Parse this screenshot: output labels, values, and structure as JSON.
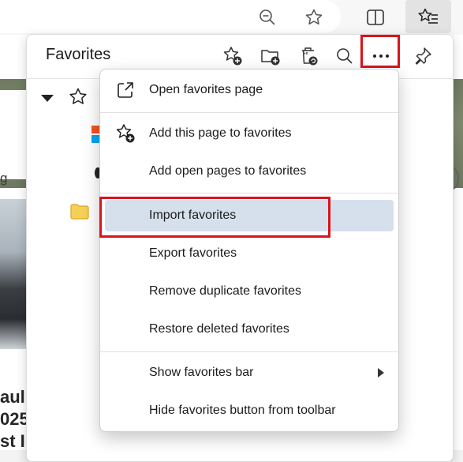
{
  "toolbar": {
    "icons": [
      "zoom-out-icon",
      "favorite-star-icon",
      "split-screen-icon",
      "favorites-list-icon"
    ]
  },
  "background_page": {
    "text_fragments": [
      "ng",
      "g",
      "aul",
      "025",
      "st I"
    ]
  },
  "favorites_panel": {
    "title": "Favorites",
    "header_icons": [
      "add-favorite-icon",
      "add-folder-icon",
      "delete-icon",
      "search-icon",
      "more-options-icon",
      "pin-icon"
    ]
  },
  "menu": {
    "items": [
      {
        "label": "Open favorites page",
        "icon": "open-external-icon"
      },
      {
        "label": "Add this page to favorites",
        "icon": "add-star-icon"
      },
      {
        "label": "Add open pages to favorites",
        "icon": ""
      },
      {
        "label": "Import favorites",
        "icon": ""
      },
      {
        "label": "Export favorites",
        "icon": ""
      },
      {
        "label": "Remove duplicate favorites",
        "icon": ""
      },
      {
        "label": "Restore deleted favorites",
        "icon": ""
      },
      {
        "label": "Show favorites bar",
        "icon": ""
      },
      {
        "label": "Hide favorites button from toolbar",
        "icon": ""
      }
    ],
    "highlighted_item": "Import favorites"
  },
  "colors": {
    "highlight_red": "#d9141c",
    "hover_blue": "#d6e0ec",
    "folder_yellow": "#f6cf57"
  }
}
